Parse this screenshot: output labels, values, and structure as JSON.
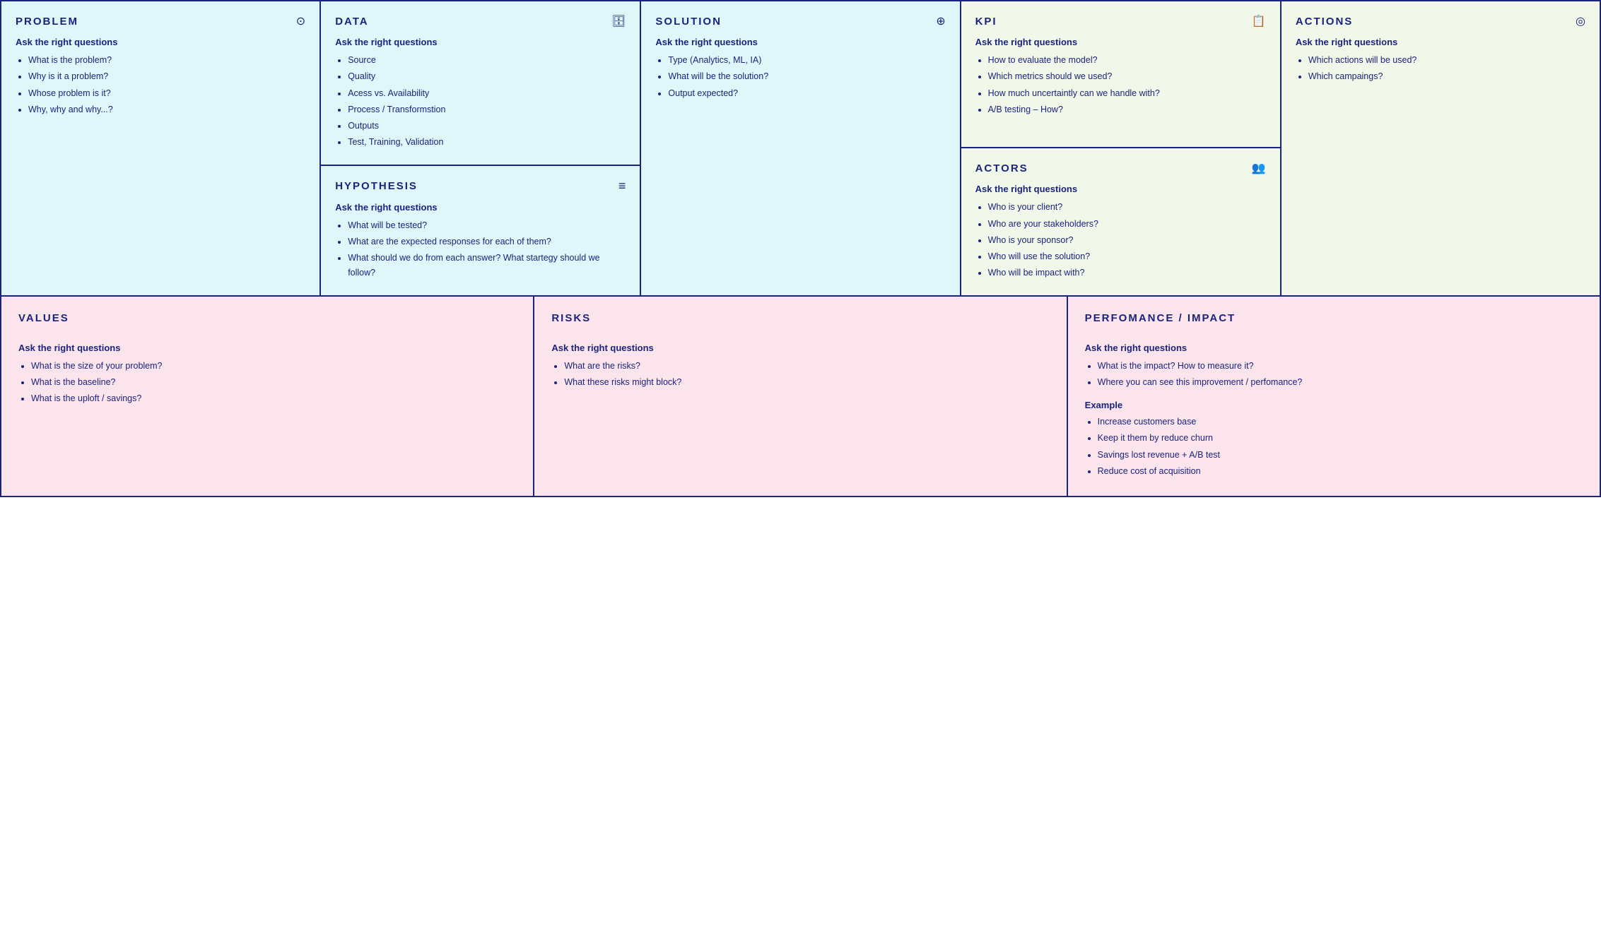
{
  "top": {
    "problem": {
      "title": "PROBLEM",
      "icon": "question-icon",
      "subtitle": "Ask the right questions",
      "bullets": [
        "What is the problem?",
        "Why is it a problem?",
        "Whose problem is it?",
        "Why, why and why...?"
      ]
    },
    "data": {
      "title": "DATA",
      "icon": "database-icon",
      "subtitle": "Ask the right questions",
      "bullets": [
        "Source",
        "Quality",
        "Acess vs. Availability",
        "Process / Transformstion",
        "Outputs",
        "Test, Training, Validation"
      ],
      "hypothesis": {
        "title": "HYPOTHESIS",
        "icon": "list-icon",
        "subtitle": "Ask the right questions",
        "bullets": [
          "What will be tested?",
          "What are the expected responses for each of them?",
          "What should we do from each answer? What startegy should we follow?"
        ]
      }
    },
    "solution": {
      "title": "SOLUTION",
      "icon": "info-icon",
      "subtitle": "Ask the right questions",
      "bullets": [
        "Type (Analytics, ML, IA)",
        "What will be the solution?",
        "Output expected?"
      ]
    },
    "kpi": {
      "title": "KPI",
      "icon": "chart-icon",
      "subtitle": "Ask the right questions",
      "bullets": [
        "How to evaluate the model?",
        "Which metrics should we used?",
        "How much uncertaintly can we handle with?",
        "A/B testing – How?"
      ],
      "actors": {
        "title": "ACTORS",
        "icon": "users-icon",
        "subtitle": "Ask the right questions",
        "bullets": [
          "Who is your client?",
          "Who are your stakeholders?",
          "Who is your sponsor?",
          "Who will use the solution?",
          "Who will be impact with?"
        ]
      }
    },
    "actions": {
      "title": "ACTIONS",
      "icon": "target-icon",
      "subtitle": "Ask the right questions",
      "bullets": [
        "Which actions will be used?",
        "Which campaings?"
      ]
    }
  },
  "bottom": {
    "values": {
      "title": "VALUES",
      "subtitle": "Ask the right questions",
      "bullets": [
        "What is the size of your problem?",
        "What is the baseline?",
        "What is the uploft / savings?"
      ]
    },
    "risks": {
      "title": "RISKS",
      "subtitle": "Ask the right questions",
      "bullets": [
        "What are the risks?",
        "What these risks might block?"
      ]
    },
    "performance": {
      "title": "PERFOMANCE / IMPACT",
      "subtitle": "Ask the right questions",
      "bullets": [
        "What is the impact? How to measure it?",
        "Where you can see this improvement / perfomance?"
      ],
      "example_label": "Example",
      "example_bullets": [
        "Increase customers base",
        "Keep it them by reduce churn",
        "Savings lost revenue + A/B test",
        "Reduce cost of acquisition"
      ]
    }
  }
}
